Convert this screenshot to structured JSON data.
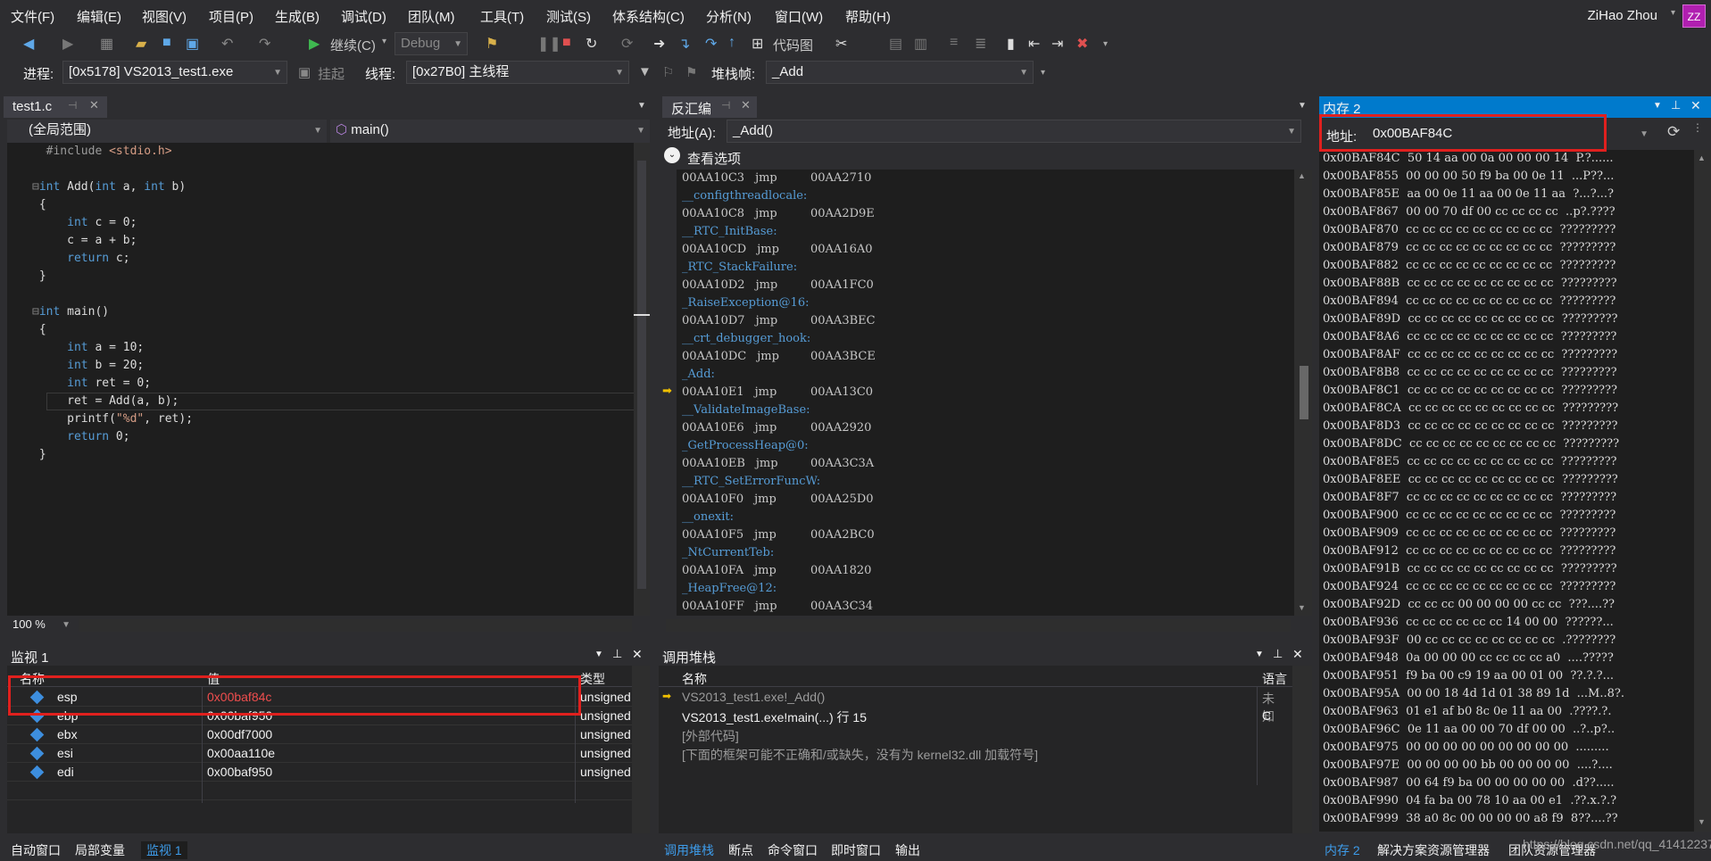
{
  "menu": [
    "文件(F)",
    "编辑(E)",
    "视图(V)",
    "项目(P)",
    "生成(B)",
    "调试(D)",
    "团队(M)",
    "工具(T)",
    "测试(S)",
    "体系结构(C)",
    "分析(N)",
    "窗口(W)",
    "帮助(H)"
  ],
  "user": "ZiHao Zhou",
  "avatar": "ZZ",
  "toolbar": {
    "continue": "继续(C)",
    "config": "Debug",
    "codemap": "代码图"
  },
  "debugbar": {
    "process_label": "进程:",
    "process": "[0x5178] VS2013_test1.exe",
    "suspend": "挂起",
    "thread_label": "线程:",
    "thread": "[0x27B0] 主线程",
    "stackframe_label": "堆栈帧:",
    "stackframe": "_Add"
  },
  "editor": {
    "tab": "test1.c",
    "scope": "(全局范围)",
    "func": "main()",
    "zoom": "100 %"
  },
  "disasm": {
    "tab": "反汇编",
    "addr_label": "地址(A):",
    "addr": "_Add()",
    "options": "查看选项",
    "lines": [
      {
        "a": "00AA10C3",
        "op": "jmp",
        "t": "00AA2710"
      },
      {
        "s": "__configthreadlocale:"
      },
      {
        "a": "00AA10C8",
        "op": "jmp",
        "t": "00AA2D9E"
      },
      {
        "s": "__RTC_InitBase:"
      },
      {
        "a": "00AA10CD",
        "op": "jmp",
        "t": "00AA16A0"
      },
      {
        "s": "_RTC_StackFailure:"
      },
      {
        "a": "00AA10D2",
        "op": "jmp",
        "t": "00AA1FC0"
      },
      {
        "s": "_RaiseException@16:"
      },
      {
        "a": "00AA10D7",
        "op": "jmp",
        "t": "00AA3BEC"
      },
      {
        "s": "__crt_debugger_hook:"
      },
      {
        "a": "00AA10DC",
        "op": "jmp",
        "t": "00AA3BCE"
      },
      {
        "s": "_Add:"
      },
      {
        "a": "00AA10E1",
        "op": "jmp",
        "t": "00AA13C0"
      },
      {
        "s": "__ValidateImageBase:"
      },
      {
        "a": "00AA10E6",
        "op": "jmp",
        "t": "00AA2920"
      },
      {
        "s": "_GetProcessHeap@0:"
      },
      {
        "a": "00AA10EB",
        "op": "jmp",
        "t": "00AA3C3A"
      },
      {
        "s": "__RTC_SetErrorFuncW:"
      },
      {
        "a": "00AA10F0",
        "op": "jmp",
        "t": "00AA25D0"
      },
      {
        "s": "__onexit:"
      },
      {
        "a": "00AA10F5",
        "op": "jmp",
        "t": "00AA2BC0"
      },
      {
        "s": "_NtCurrentTeb:"
      },
      {
        "a": "00AA10FA",
        "op": "jmp",
        "t": "00AA1820"
      },
      {
        "s": "_HeapFree@12:"
      },
      {
        "a": "00AA10FF",
        "op": "jmp",
        "t": "00AA3C34"
      }
    ]
  },
  "memory": {
    "tab": "内存 2",
    "addr_label": "地址:",
    "addr": "0x00BAF84C",
    "rows": [
      "0x00BAF84C  50 14 aa 00 0a 00 00 00 14  P.?......",
      "0x00BAF855  00 00 00 50 f9 ba 00 0e 11  ...P??...",
      "0x00BAF85E  aa 00 0e 11 aa 00 0e 11 aa  ?...?...?",
      "0x00BAF867  00 00 70 df 00 cc cc cc cc  ..p?.????",
      "0x00BAF870  cc cc cc cc cc cc cc cc cc  ?????????",
      "0x00BAF879  cc cc cc cc cc cc cc cc cc  ?????????",
      "0x00BAF882  cc cc cc cc cc cc cc cc cc  ?????????",
      "0x00BAF88B  cc cc cc cc cc cc cc cc cc  ?????????",
      "0x00BAF894  cc cc cc cc cc cc cc cc cc  ?????????",
      "0x00BAF89D  cc cc cc cc cc cc cc cc cc  ?????????",
      "0x00BAF8A6  cc cc cc cc cc cc cc cc cc  ?????????",
      "0x00BAF8AF  cc cc cc cc cc cc cc cc cc  ?????????",
      "0x00BAF8B8  cc cc cc cc cc cc cc cc cc  ?????????",
      "0x00BAF8C1  cc cc cc cc cc cc cc cc cc  ?????????",
      "0x00BAF8CA  cc cc cc cc cc cc cc cc cc  ?????????",
      "0x00BAF8D3  cc cc cc cc cc cc cc cc cc  ?????????",
      "0x00BAF8DC  cc cc cc cc cc cc cc cc cc  ?????????",
      "0x00BAF8E5  cc cc cc cc cc cc cc cc cc  ?????????",
      "0x00BAF8EE  cc cc cc cc cc cc cc cc cc  ?????????",
      "0x00BAF8F7  cc cc cc cc cc cc cc cc cc  ?????????",
      "0x00BAF900  cc cc cc cc cc cc cc cc cc  ?????????",
      "0x00BAF909  cc cc cc cc cc cc cc cc cc  ?????????",
      "0x00BAF912  cc cc cc cc cc cc cc cc cc  ?????????",
      "0x00BAF91B  cc cc cc cc cc cc cc cc cc  ?????????",
      "0x00BAF924  cc cc cc cc cc cc cc cc cc  ?????????",
      "0x00BAF92D  cc cc cc 00 00 00 00 cc cc  ???....??",
      "0x00BAF936  cc cc cc cc cc cc 14 00 00  ??????...",
      "0x00BAF93F  00 cc cc cc cc cc cc cc cc  .????????",
      "0x00BAF948  0a 00 00 00 cc cc cc cc a0  ....?????",
      "0x00BAF951  f9 ba 00 c9 19 aa 00 01 00  ??.?.?...",
      "0x00BAF95A  00 00 18 4d 1d 01 38 89 1d  ...M..8?.",
      "0x00BAF963  01 e1 af b0 8c 0e 11 aa 00  .????.?.",
      "0x00BAF96C  0e 11 aa 00 00 70 df 00 00  ..?..p?..",
      "0x00BAF975  00 00 00 00 00 00 00 00 00  .........",
      "0x00BAF97E  00 00 00 00 bb 00 00 00 00  ....?....",
      "0x00BAF987  00 64 f9 ba 00 00 00 00 00  .d??.....",
      "0x00BAF990  04 fa ba 00 78 10 aa 00 e1  .??.x.?.?",
      "0x00BAF999  38 a0 8c 00 00 00 00 a8 f9  8??....??"
    ]
  },
  "watch": {
    "title": "监视 1",
    "cols": [
      "名称",
      "值",
      "类型"
    ],
    "rows": [
      {
        "name": "esp",
        "value": "0x00baf84c",
        "type": "unsigned"
      },
      {
        "name": "ebp",
        "value": "0x00baf950",
        "type": "unsigned"
      },
      {
        "name": "ebx",
        "value": "0x00df7000",
        "type": "unsigned"
      },
      {
        "name": "esi",
        "value": "0x00aa110e",
        "type": "unsigned"
      },
      {
        "name": "edi",
        "value": "0x00baf950",
        "type": "unsigned"
      }
    ]
  },
  "callstack": {
    "title": "调用堆栈",
    "cols": [
      "名称",
      "语言"
    ],
    "rows": [
      {
        "name": "VS2013_test1.exe!_Add()",
        "lang": "未知"
      },
      {
        "name": "VS2013_test1.exe!main(...) 行 15",
        "lang": "C"
      },
      {
        "name": "[外部代码]",
        "lang": ""
      },
      {
        "name": "[下面的框架可能不正确和/或缺失，没有为 kernel32.dll 加载符号]",
        "lang": ""
      }
    ]
  },
  "bottom_left": [
    "自动窗口",
    "局部变量",
    "监视 1"
  ],
  "bottom_mid": [
    "调用堆栈",
    "断点",
    "命令窗口",
    "即时窗口",
    "输出"
  ],
  "bottom_right": [
    "内存 2",
    "解决方案资源管理器",
    "团队资源管理器"
  ],
  "watermark": "https://blog.csdn.net/qq_41412237"
}
